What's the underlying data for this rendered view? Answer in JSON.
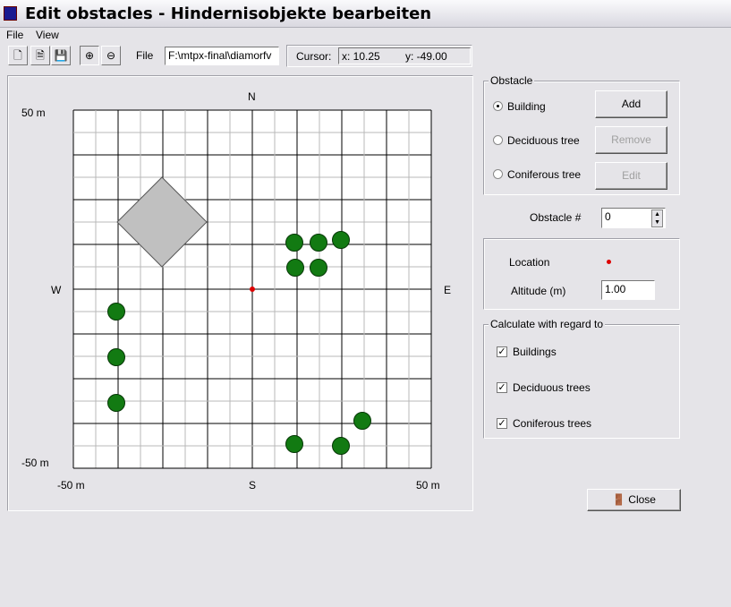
{
  "window": {
    "title": "Edit obstacles - Hindernisobjekte bearbeiten"
  },
  "menu": [
    "File",
    "View"
  ],
  "toolbar": {
    "file_label": "File",
    "file_value": "F:\\mtpx-final\\diamorfv",
    "cursor_label": "Cursor:",
    "cursor_x": "x: 10.25",
    "cursor_y": "y: -49.00",
    "icons": [
      "new-file-icon",
      "open-file-icon",
      "save-file-icon",
      "zoom-in-icon",
      "zoom-out-icon"
    ]
  },
  "map": {
    "north": "N",
    "south": "S",
    "west": "W",
    "east": "E",
    "y_top": "50 m",
    "y_bottom": "-50 m",
    "x_left": "-50 m",
    "x_right": "50 m",
    "xlim": [
      -50,
      50
    ],
    "ylim": [
      -50,
      50
    ],
    "building": [
      [
        -25.25,
        31.25
      ],
      [
        -12.75,
        18.75
      ],
      [
        -25.25,
        6.25
      ],
      [
        -37.75,
        18.75
      ]
    ],
    "trees": [
      [
        11.75,
        13
      ],
      [
        18.5,
        13
      ],
      [
        24.75,
        13.75
      ],
      [
        12,
        6
      ],
      [
        18.5,
        6
      ],
      [
        -38,
        -6.25
      ],
      [
        -38,
        -19
      ],
      [
        -38,
        -31.75
      ],
      [
        30.75,
        -36.75
      ],
      [
        11.75,
        -43.25
      ],
      [
        24.75,
        -43.75
      ]
    ],
    "selected_location": [
      0,
      0
    ],
    "colors": {
      "tree": "#127a12",
      "building": "#c0c0c0",
      "location": "#dd0000"
    }
  },
  "obstacle": {
    "legend": "Obstacle",
    "types": [
      {
        "label": "Building",
        "selected": true
      },
      {
        "label": "Deciduous tree",
        "selected": false
      },
      {
        "label": "Coniferous tree",
        "selected": false
      }
    ],
    "add": "Add",
    "remove": "Remove",
    "edit": "Edit",
    "number_label": "Obstacle #",
    "number_value": "0",
    "location_label": "Location",
    "altitude_label": "Altitude (m)",
    "altitude_value": "1.00"
  },
  "calculate": {
    "legend": "Calculate with regard to",
    "items": [
      {
        "label": "Buildings",
        "checked": true
      },
      {
        "label": "Deciduous trees",
        "checked": true
      },
      {
        "label": "Coniferous trees",
        "checked": true
      }
    ]
  },
  "close": "Close"
}
